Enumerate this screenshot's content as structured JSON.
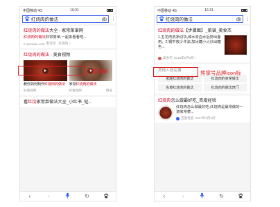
{
  "status_bar": {
    "carrier": "中国移动",
    "network": "4G",
    "time": "16:31"
  },
  "search": {
    "query": "红烧肉的做法"
  },
  "left": {
    "result1": {
      "title_hl": "红烧肉的做法",
      "title_rest": "大全 - 家常菜谱网",
      "snippet_hl": "红烧肉的做法",
      "snippet_rest": "非常简单,一起来看看吧...",
      "source": "m.jiacaipu.com",
      "category": "家常菜 · 红烧肉"
    },
    "result2": {
      "title_hl": "红烧肉的做法",
      "title_rest": " - 美食视频",
      "video1_caption_pre": "教你如何制作",
      "video1_caption_hl": "红烧肉的做法",
      "video2_caption_pre": "家常",
      "video2_caption_hl": "红烧肉的做法",
      "video1_author": "好看视频",
      "video2_author": "好看视频",
      "preview_label": "预览"
    },
    "result3": {
      "title_pre": "看",
      "title_hl": "红烧",
      "title_rest": "家常菜做法大全_小红书_轻..."
    },
    "annotation": "正常效果"
  },
  "right": {
    "result1": {
      "title_hl": "红烧肉的做法",
      "title_rest": "【步骤图】_菜谱_美食杰",
      "snippet": "1.五花肉洗净切块,焯水去血水后捞出备用。2.锅中放少许油,加冰糖小火炒出糖色...",
      "brand": "美食杰",
      "date": "2018年5月9日"
    },
    "related": {
      "caption": "其他人还在搜",
      "chips": [
        "家庭红烧肉的做法",
        "红烧肉的家常做法",
        "东坡红烧肉的做法",
        "红烧肉的做法窍门"
      ]
    },
    "result2": {
      "title_hl": "红烧肉",
      "title_rest": "怎么做最好吃_百度经验",
      "snippet": "红烧肉怎么做最好吃,红烧肉是最常做的一道家常菜...",
      "source": "百度经验",
      "date": "2017年3月2日"
    },
    "annotation": "熊掌号品牌icon标"
  },
  "icons": {
    "paw": "baidu-paw-icon",
    "camera": "camera-icon",
    "more": "more-vertical-icon",
    "back": "back-arrow-icon",
    "forward": "forward-arrow-icon",
    "mic": "microphone-icon",
    "refresh": "refresh-icon"
  },
  "colors": {
    "highlight": "#d0021b",
    "annotation": "#e02020",
    "accent": "#2a5cf5"
  }
}
